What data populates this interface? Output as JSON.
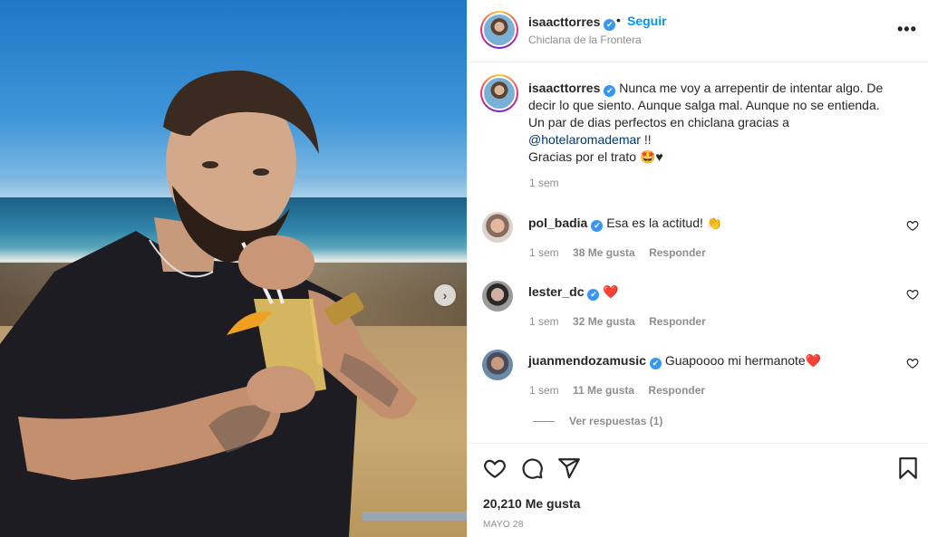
{
  "post": {
    "username": "isaacttorres",
    "verified_icon": "✔",
    "separator": "•",
    "follow_label": "Seguir",
    "location": "Chiclana de la Frontera",
    "more_label": "•••",
    "carousel_next": "›",
    "caption": {
      "username": "isaacttorres",
      "line1": "Nunca me voy a arrepentir de intentar algo. De",
      "line2": "decir lo que siento. Aunque salga mal. Aunque no se entienda.",
      "line3": "Un par de dias perfectos en chiclana gracias a",
      "mention": "@hotelaromademar",
      "mention_suffix": " !!",
      "line5": "Gracias por el trato 🤩♥",
      "time": "1 sem"
    },
    "likes": "20,210 Me gusta",
    "date": "MAYO 28"
  },
  "comments": [
    {
      "username": "pol_badia",
      "text": "Esa es la actitud! 👏",
      "time": "1 sem",
      "likes": "38 Me gusta",
      "reply": "Responder"
    },
    {
      "username": "lester_dc",
      "text": "❤️",
      "time": "1 sem",
      "likes": "32 Me gusta",
      "reply": "Responder"
    },
    {
      "username": "juanmendozamusic",
      "text": "Guapoooo mi hermanote❤️",
      "time": "1 sem",
      "likes": "11 Me gusta",
      "reply": "Responder"
    }
  ],
  "view_replies": "Ver respuestas (1)",
  "icons": {
    "like": "heart-icon",
    "comment": "comment-icon",
    "share": "paper-plane-icon",
    "save": "bookmark-icon"
  },
  "colors": {
    "follow_blue": "#0095f6",
    "verified_blue": "#3897f0",
    "mention": "#00376b",
    "muted": "#8e8e8e"
  }
}
